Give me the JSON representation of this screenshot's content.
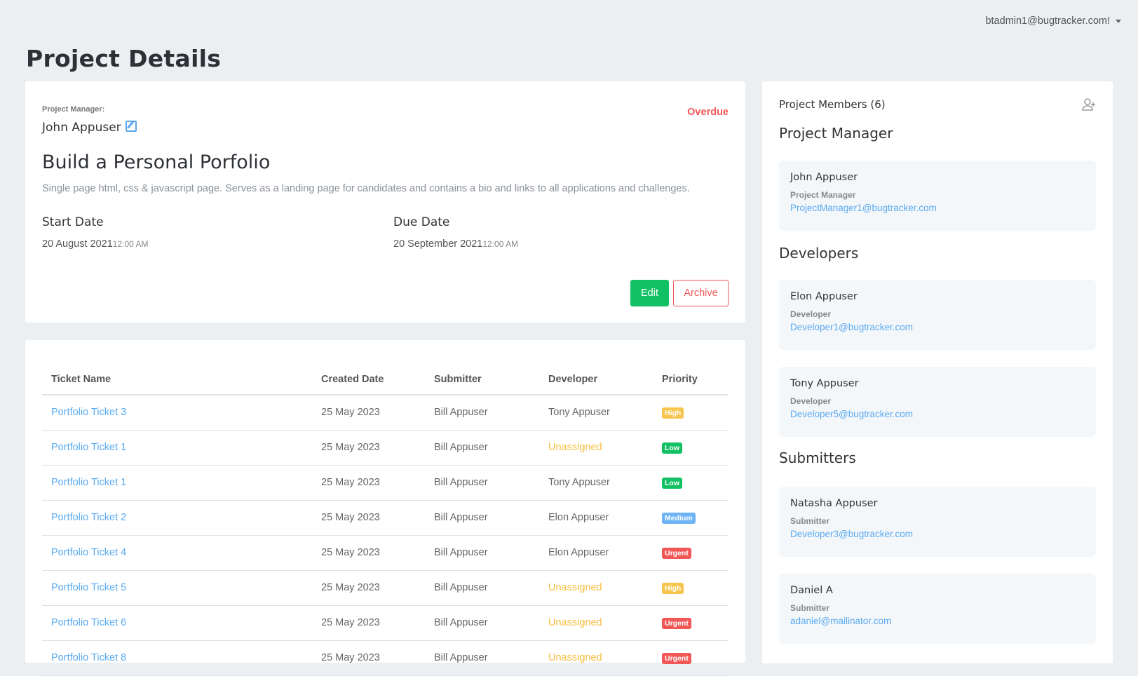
{
  "header": {
    "user": "btadmin1@bugtracker.com!"
  },
  "page_title": "Project Details",
  "project": {
    "pm_label": "Project Manager:",
    "pm_name": "John Appuser",
    "status": "Overdue",
    "title": "Build a Personal Porfolio",
    "description": "Single page html, css & javascript page. Serves as a landing page for candidates and contains a bio and links to all applications and challenges.",
    "start_label": "Start Date",
    "start_date": "20 August 2021",
    "start_time": "12:00 AM",
    "due_label": "Due Date",
    "due_date": "20 September 2021",
    "due_time": "12:00 AM",
    "edit_label": "Edit",
    "archive_label": "Archive"
  },
  "tickets": {
    "columns": [
      "Ticket Name",
      "Created Date",
      "Submitter",
      "Developer",
      "Priority"
    ],
    "rows": [
      {
        "name": "Portfolio Ticket 3",
        "created": "25 May 2023",
        "submitter": "Bill Appuser",
        "developer": "Tony Appuser",
        "priority": "High"
      },
      {
        "name": "Portfolio Ticket 1",
        "created": "25 May 2023",
        "submitter": "Bill Appuser",
        "developer": "Unassigned",
        "priority": "Low"
      },
      {
        "name": "Portfolio Ticket 1",
        "created": "25 May 2023",
        "submitter": "Bill Appuser",
        "developer": "Tony Appuser",
        "priority": "Low"
      },
      {
        "name": "Portfolio Ticket 2",
        "created": "25 May 2023",
        "submitter": "Bill Appuser",
        "developer": "Elon Appuser",
        "priority": "Medium"
      },
      {
        "name": "Portfolio Ticket 4",
        "created": "25 May 2023",
        "submitter": "Bill Appuser",
        "developer": "Elon Appuser",
        "priority": "Urgent"
      },
      {
        "name": "Portfolio Ticket 5",
        "created": "25 May 2023",
        "submitter": "Bill Appuser",
        "developer": "Unassigned",
        "priority": "High"
      },
      {
        "name": "Portfolio Ticket 6",
        "created": "25 May 2023",
        "submitter": "Bill Appuser",
        "developer": "Unassigned",
        "priority": "Urgent"
      },
      {
        "name": "Portfolio Ticket 8",
        "created": "25 May 2023",
        "submitter": "Bill Appuser",
        "developer": "Unassigned",
        "priority": "Urgent"
      }
    ]
  },
  "priority_colors": {
    "High": "#f7c54e",
    "Low": "#12c163",
    "Medium": "#6cb4f5",
    "Urgent": "#f25757"
  },
  "members": {
    "title": "Project Members (6)",
    "sections": [
      {
        "heading": "Project Manager",
        "people": [
          {
            "name": "John Appuser",
            "role": "Project Manager",
            "email": "ProjectManager1@bugtracker.com"
          }
        ]
      },
      {
        "heading": "Developers",
        "people": [
          {
            "name": "Elon Appuser",
            "role": "Developer",
            "email": "Developer1@bugtracker.com"
          },
          {
            "name": "Tony Appuser",
            "role": "Developer",
            "email": "Developer5@bugtracker.com"
          }
        ]
      },
      {
        "heading": "Submitters",
        "people": [
          {
            "name": "Natasha Appuser",
            "role": "Submitter",
            "email": "Developer3@bugtracker.com"
          },
          {
            "name": "Daniel A",
            "role": "Submitter",
            "email": "adaniel@mailinator.com"
          }
        ]
      }
    ]
  }
}
